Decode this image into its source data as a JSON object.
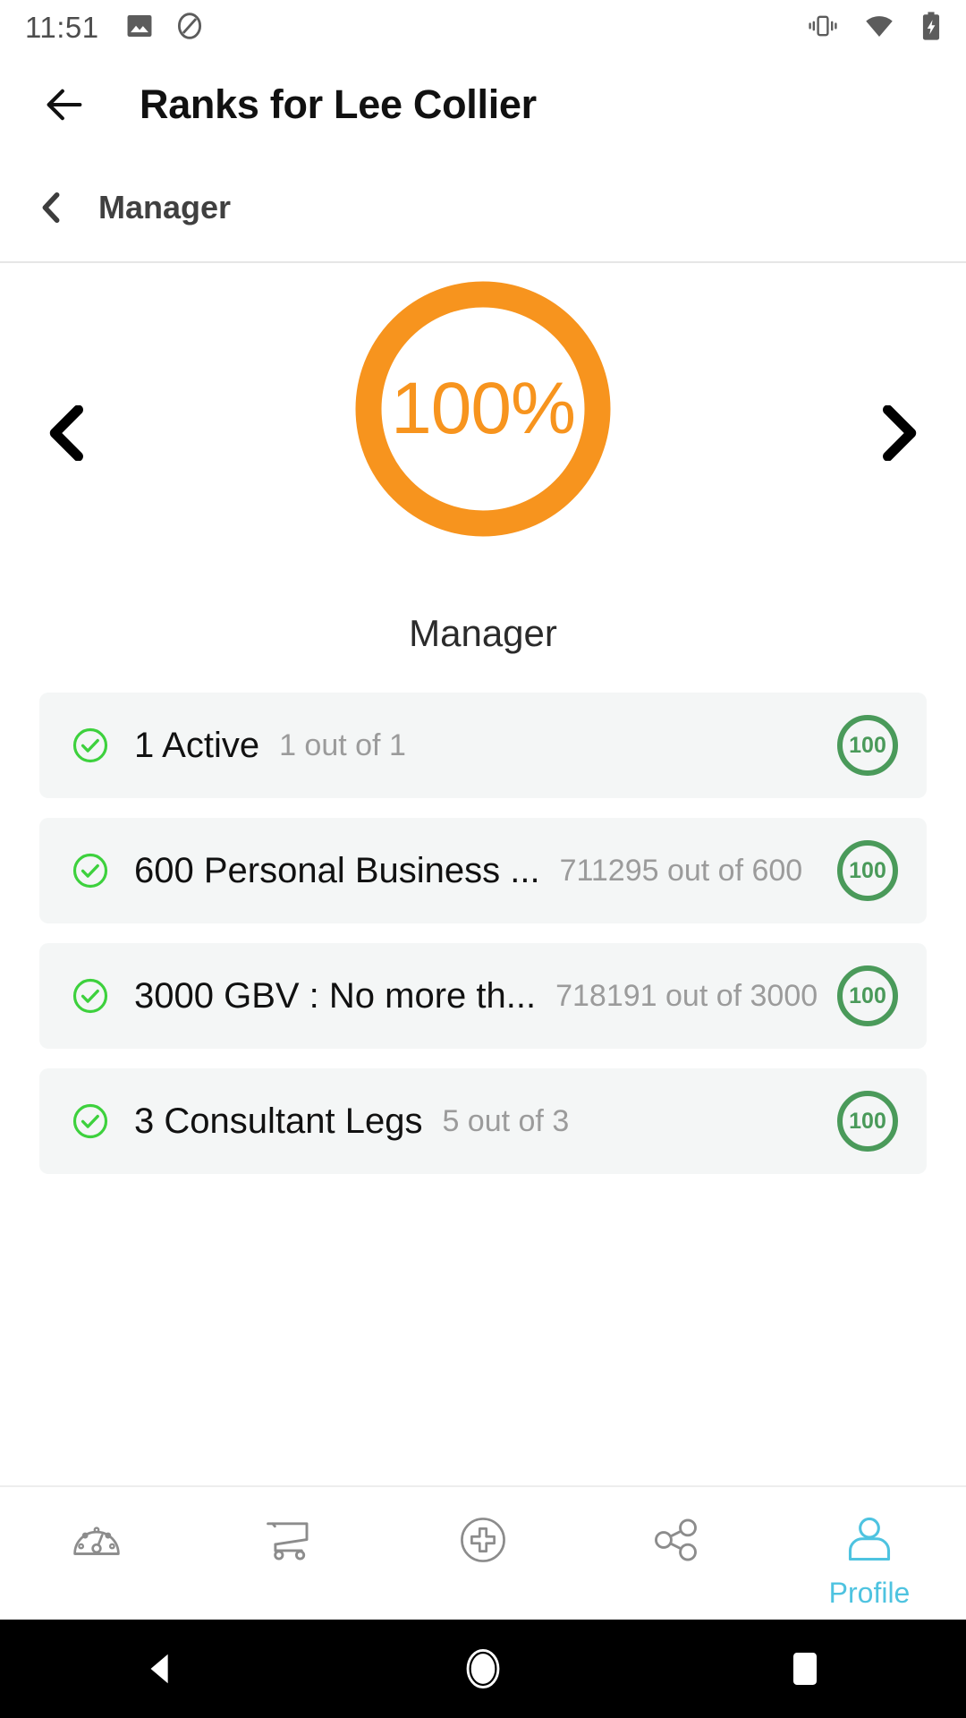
{
  "status_bar": {
    "time": "11:51",
    "left_icons": [
      "image-icon",
      "do-not-disturb-icon"
    ],
    "right_icons": [
      "vibrate-icon",
      "wifi-icon",
      "battery-charging-icon"
    ]
  },
  "app_bar": {
    "back_icon": "arrow-left-icon",
    "title": "Ranks for Lee Collier"
  },
  "breadcrumb": {
    "chevron_icon": "chevron-left-icon",
    "label": "Manager"
  },
  "rank_carousel": {
    "prev_icon": "chevron-left-icon",
    "next_icon": "chevron-right-icon",
    "percent_label": "100%",
    "percent_value": 100,
    "ring_color": "#F7941E",
    "rank_name": "Manager"
  },
  "requirements": [
    {
      "status_icon": "check-circle-icon",
      "title": "1 Active",
      "progress": "1 out of 1",
      "score": "100"
    },
    {
      "status_icon": "check-circle-icon",
      "title": "600 Personal Business ...",
      "progress": "711295 out of 600",
      "score": "100"
    },
    {
      "status_icon": "check-circle-icon",
      "title": "3000 GBV : No more th...",
      "progress": "718191 out of 3000",
      "score": "100"
    },
    {
      "status_icon": "check-circle-icon",
      "title": "3 Consultant Legs",
      "progress": "5 out of 3",
      "score": "100"
    }
  ],
  "tab_bar": {
    "active_color": "#4EC3E0",
    "inactive_color": "#8C8C8C",
    "tabs": [
      {
        "icon": "dashboard-gauge-icon",
        "label": "",
        "active": false
      },
      {
        "icon": "shopping-cart-icon",
        "label": "",
        "active": false
      },
      {
        "icon": "plus-circle-icon",
        "label": "",
        "active": false
      },
      {
        "icon": "share-icon",
        "label": "",
        "active": false
      },
      {
        "icon": "profile-person-icon",
        "label": "Profile",
        "active": true
      }
    ]
  },
  "android_nav": {
    "buttons": [
      {
        "icon": "nav-back-triangle-icon"
      },
      {
        "icon": "nav-home-circle-icon"
      },
      {
        "icon": "nav-recents-square-icon"
      }
    ]
  },
  "colors": {
    "orange": "#F7941E",
    "badge_green": "#4A9A5A",
    "check_green": "#3DD13D",
    "card_bg": "#F4F6F6",
    "muted_text": "#9B9B9B",
    "cyan": "#4EC3E0"
  }
}
